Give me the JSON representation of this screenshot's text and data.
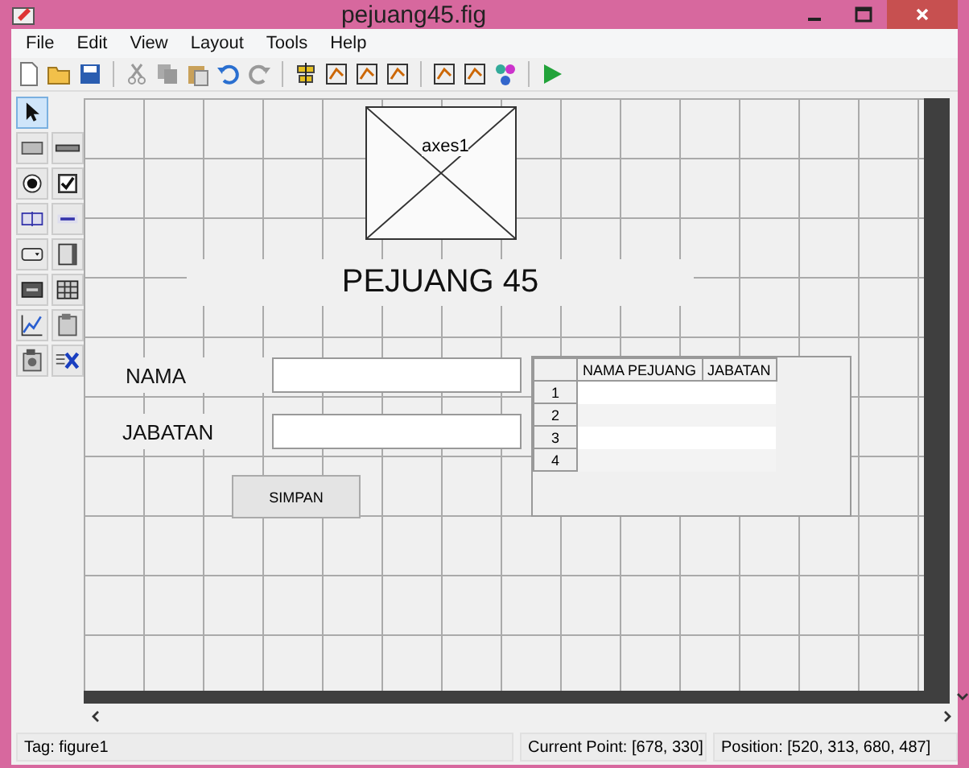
{
  "window": {
    "title": "pejuang45.fig"
  },
  "menu": [
    "File",
    "Edit",
    "View",
    "Layout",
    "Tools",
    "Help"
  ],
  "palette": [
    {
      "kind": "select",
      "selected": true
    },
    {
      "kind": "push",
      "selected": false
    },
    {
      "kind": "slider",
      "selected": false
    },
    {
      "kind": "radio",
      "selected": false
    },
    {
      "kind": "check",
      "selected": false
    },
    {
      "kind": "edit",
      "selected": false
    },
    {
      "kind": "text",
      "selected": false
    },
    {
      "kind": "popup",
      "selected": false
    },
    {
      "kind": "listbox",
      "selected": false
    },
    {
      "kind": "toggle",
      "selected": false
    },
    {
      "kind": "table",
      "selected": false
    },
    {
      "kind": "axes",
      "selected": false
    },
    {
      "kind": "panel",
      "selected": false
    },
    {
      "kind": "buttongroup",
      "selected": false
    },
    {
      "kind": "activex",
      "selected": false
    }
  ],
  "canvas": {
    "axes_label": "axes1",
    "heading": "PEJUANG 45",
    "labels": [
      "NAMA",
      "JABATAN"
    ],
    "button": "SIMPAN",
    "table": {
      "columns": [
        "NAMA PEJUANG",
        "JABATAN"
      ],
      "row_headers": [
        "1",
        "2",
        "3",
        "4"
      ]
    }
  },
  "status_bar": {
    "tag": "Tag: figure1",
    "current_point": "Current Point:  [678, 330]",
    "position": "Position: [520, 313, 680, 487]"
  }
}
